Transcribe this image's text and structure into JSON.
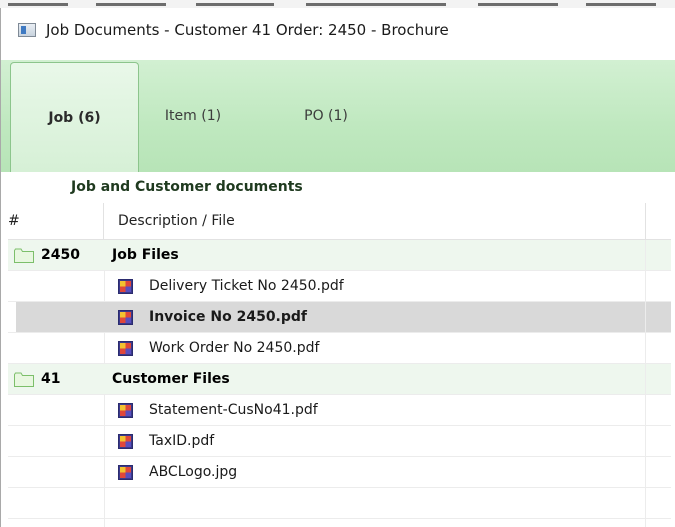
{
  "window": {
    "title": "Job Documents - Customer 41 Order: 2450 - Brochure"
  },
  "tabs": [
    {
      "label": "Job (6)",
      "active": true
    },
    {
      "label": "Item (1)",
      "active": false
    },
    {
      "label": "PO (1)",
      "active": false
    }
  ],
  "section": {
    "heading": "Job and Customer documents"
  },
  "grid": {
    "columns": [
      "#",
      "Description / File"
    ],
    "groups": [
      {
        "number": "2450",
        "name": "Job Files",
        "files": [
          {
            "name": "Delivery Ticket No 2450.pdf",
            "selected": false
          },
          {
            "name": "Invoice No 2450.pdf",
            "selected": true
          },
          {
            "name": "Work Order No 2450.pdf",
            "selected": false
          }
        ]
      },
      {
        "number": "41",
        "name": "Customer Files",
        "files": [
          {
            "name": "Statement-CusNo41.pdf",
            "selected": false
          },
          {
            "name": "TaxID.pdf",
            "selected": false
          },
          {
            "name": "ABCLogo.jpg",
            "selected": false
          }
        ]
      }
    ]
  },
  "icons": {
    "folder": "folder-icon",
    "file": "document-file-icon",
    "app": "app-window-icon"
  },
  "colors": {
    "tab_strip": "#c4eac4",
    "group_row": "#eef7ee",
    "selected_row": "#d9d9d9"
  }
}
